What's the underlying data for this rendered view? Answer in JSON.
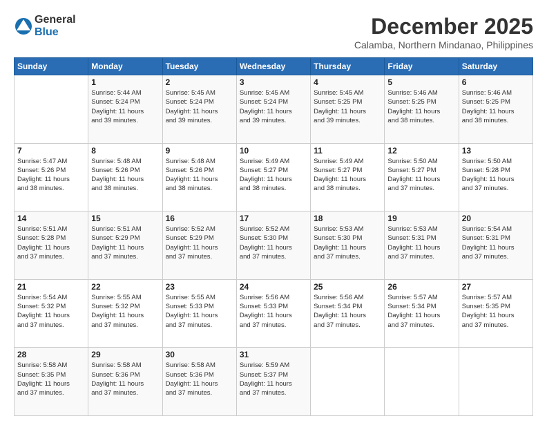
{
  "header": {
    "logo_general": "General",
    "logo_blue": "Blue",
    "month": "December 2025",
    "location": "Calamba, Northern Mindanao, Philippines"
  },
  "days_of_week": [
    "Sunday",
    "Monday",
    "Tuesday",
    "Wednesday",
    "Thursday",
    "Friday",
    "Saturday"
  ],
  "weeks": [
    [
      {
        "day": "",
        "info": ""
      },
      {
        "day": "1",
        "info": "Sunrise: 5:44 AM\nSunset: 5:24 PM\nDaylight: 11 hours\nand 39 minutes."
      },
      {
        "day": "2",
        "info": "Sunrise: 5:45 AM\nSunset: 5:24 PM\nDaylight: 11 hours\nand 39 minutes."
      },
      {
        "day": "3",
        "info": "Sunrise: 5:45 AM\nSunset: 5:24 PM\nDaylight: 11 hours\nand 39 minutes."
      },
      {
        "day": "4",
        "info": "Sunrise: 5:45 AM\nSunset: 5:25 PM\nDaylight: 11 hours\nand 39 minutes."
      },
      {
        "day": "5",
        "info": "Sunrise: 5:46 AM\nSunset: 5:25 PM\nDaylight: 11 hours\nand 38 minutes."
      },
      {
        "day": "6",
        "info": "Sunrise: 5:46 AM\nSunset: 5:25 PM\nDaylight: 11 hours\nand 38 minutes."
      }
    ],
    [
      {
        "day": "7",
        "info": "Sunrise: 5:47 AM\nSunset: 5:26 PM\nDaylight: 11 hours\nand 38 minutes."
      },
      {
        "day": "8",
        "info": "Sunrise: 5:48 AM\nSunset: 5:26 PM\nDaylight: 11 hours\nand 38 minutes."
      },
      {
        "day": "9",
        "info": "Sunrise: 5:48 AM\nSunset: 5:26 PM\nDaylight: 11 hours\nand 38 minutes."
      },
      {
        "day": "10",
        "info": "Sunrise: 5:49 AM\nSunset: 5:27 PM\nDaylight: 11 hours\nand 38 minutes."
      },
      {
        "day": "11",
        "info": "Sunrise: 5:49 AM\nSunset: 5:27 PM\nDaylight: 11 hours\nand 38 minutes."
      },
      {
        "day": "12",
        "info": "Sunrise: 5:50 AM\nSunset: 5:27 PM\nDaylight: 11 hours\nand 37 minutes."
      },
      {
        "day": "13",
        "info": "Sunrise: 5:50 AM\nSunset: 5:28 PM\nDaylight: 11 hours\nand 37 minutes."
      }
    ],
    [
      {
        "day": "14",
        "info": "Sunrise: 5:51 AM\nSunset: 5:28 PM\nDaylight: 11 hours\nand 37 minutes."
      },
      {
        "day": "15",
        "info": "Sunrise: 5:51 AM\nSunset: 5:29 PM\nDaylight: 11 hours\nand 37 minutes."
      },
      {
        "day": "16",
        "info": "Sunrise: 5:52 AM\nSunset: 5:29 PM\nDaylight: 11 hours\nand 37 minutes."
      },
      {
        "day": "17",
        "info": "Sunrise: 5:52 AM\nSunset: 5:30 PM\nDaylight: 11 hours\nand 37 minutes."
      },
      {
        "day": "18",
        "info": "Sunrise: 5:53 AM\nSunset: 5:30 PM\nDaylight: 11 hours\nand 37 minutes."
      },
      {
        "day": "19",
        "info": "Sunrise: 5:53 AM\nSunset: 5:31 PM\nDaylight: 11 hours\nand 37 minutes."
      },
      {
        "day": "20",
        "info": "Sunrise: 5:54 AM\nSunset: 5:31 PM\nDaylight: 11 hours\nand 37 minutes."
      }
    ],
    [
      {
        "day": "21",
        "info": "Sunrise: 5:54 AM\nSunset: 5:32 PM\nDaylight: 11 hours\nand 37 minutes."
      },
      {
        "day": "22",
        "info": "Sunrise: 5:55 AM\nSunset: 5:32 PM\nDaylight: 11 hours\nand 37 minutes."
      },
      {
        "day": "23",
        "info": "Sunrise: 5:55 AM\nSunset: 5:33 PM\nDaylight: 11 hours\nand 37 minutes."
      },
      {
        "day": "24",
        "info": "Sunrise: 5:56 AM\nSunset: 5:33 PM\nDaylight: 11 hours\nand 37 minutes."
      },
      {
        "day": "25",
        "info": "Sunrise: 5:56 AM\nSunset: 5:34 PM\nDaylight: 11 hours\nand 37 minutes."
      },
      {
        "day": "26",
        "info": "Sunrise: 5:57 AM\nSunset: 5:34 PM\nDaylight: 11 hours\nand 37 minutes."
      },
      {
        "day": "27",
        "info": "Sunrise: 5:57 AM\nSunset: 5:35 PM\nDaylight: 11 hours\nand 37 minutes."
      }
    ],
    [
      {
        "day": "28",
        "info": "Sunrise: 5:58 AM\nSunset: 5:35 PM\nDaylight: 11 hours\nand 37 minutes."
      },
      {
        "day": "29",
        "info": "Sunrise: 5:58 AM\nSunset: 5:36 PM\nDaylight: 11 hours\nand 37 minutes."
      },
      {
        "day": "30",
        "info": "Sunrise: 5:58 AM\nSunset: 5:36 PM\nDaylight: 11 hours\nand 37 minutes."
      },
      {
        "day": "31",
        "info": "Sunrise: 5:59 AM\nSunset: 5:37 PM\nDaylight: 11 hours\nand 37 minutes."
      },
      {
        "day": "",
        "info": ""
      },
      {
        "day": "",
        "info": ""
      },
      {
        "day": "",
        "info": ""
      }
    ]
  ]
}
